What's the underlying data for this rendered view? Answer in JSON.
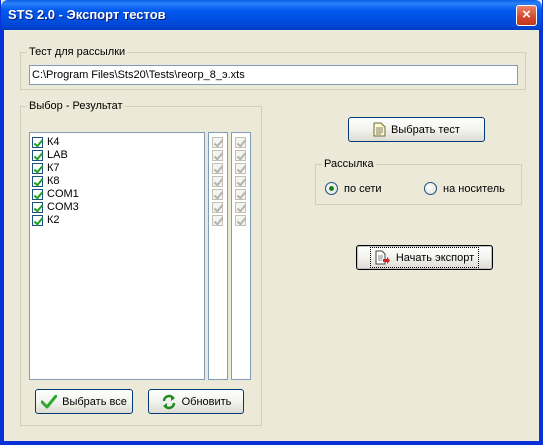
{
  "window": {
    "title": "STS 2.0 - Экспорт тестов",
    "close_symbol": "×"
  },
  "test_group": {
    "legend": "Тест для рассылки",
    "path_value": "C:\\Program Files\\Sts20\\Tests\\геогр_8_э.xts"
  },
  "results_group": {
    "legend": "Выбор - Результат",
    "items": [
      {
        "label": "К4",
        "checked": true
      },
      {
        "label": "LAB",
        "checked": true
      },
      {
        "label": "К7",
        "checked": true
      },
      {
        "label": "К8",
        "checked": true
      },
      {
        "label": "COM1",
        "checked": true
      },
      {
        "label": "COM3",
        "checked": true
      },
      {
        "label": "К2",
        "checked": true
      }
    ],
    "select_all_label": "Выбрать все",
    "refresh_label": "Обновить"
  },
  "buttons": {
    "choose_test_label": "Выбрать тест",
    "start_export_label": "Начать экспорт"
  },
  "distribution": {
    "legend": "Рассылка",
    "options": [
      {
        "label": "по сети",
        "selected": true
      },
      {
        "label": "на носитель",
        "selected": false
      }
    ]
  },
  "colors": {
    "titlebar": "#0058ee",
    "background": "#ece9d8",
    "accent_green": "#21a121"
  }
}
